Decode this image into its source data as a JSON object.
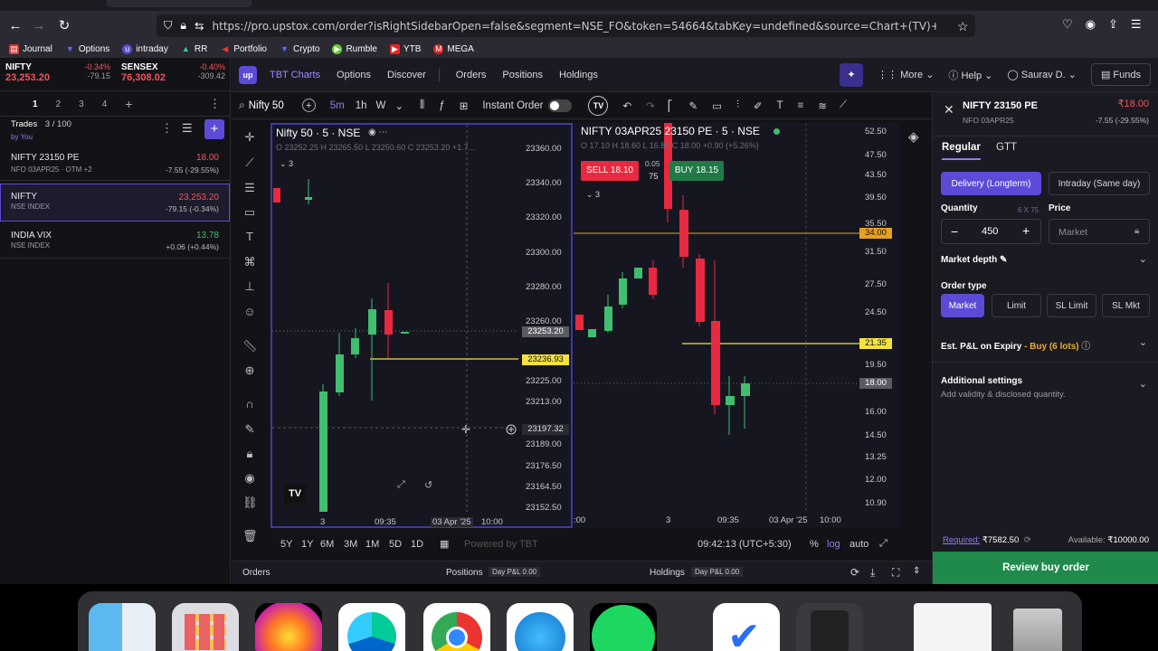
{
  "browser": {
    "url": "https://pro.upstox.com/order?isRightSidebarOpen=false&segment=NSE_FO&token=54664&tabKey=undefined&source=Chart+(TV)+Legend+CTA&action=B&order_ty",
    "bookmarks": [
      "Journal",
      "Options",
      "intraday",
      "RR",
      "Portfolio",
      "Crypto",
      "Rumble",
      "YTB",
      "MEGA"
    ]
  },
  "indices": {
    "nifty": {
      "name": "NIFTY",
      "value": "23,253.20",
      "change": "-0.34%",
      "points": "-79.15"
    },
    "sensex": {
      "name": "SENSEX",
      "value": "76,308.02",
      "change": "-0.40%",
      "points": "-309.42"
    }
  },
  "watchlist": {
    "tabs": [
      "1",
      "2",
      "3",
      "4"
    ],
    "trades_label": "Trades",
    "trades_count": "3 / 100",
    "by_you": "by You",
    "items": [
      {
        "name": "NIFTY 23150 PE",
        "sub": "NFO 03APR25",
        "tag": "OTM +2",
        "price": "18.00",
        "change": "-7.55 (-29.55%)",
        "dir": "down"
      },
      {
        "name": "NIFTY",
        "sub": "NSE INDEX",
        "tag": "",
        "price": "23,253.20",
        "change": "-79.15 (-0.34%)",
        "dir": "down"
      },
      {
        "name": "INDIA VIX",
        "sub": "NSE INDEX",
        "tag": "",
        "price": "13.78",
        "change": "+0.06 (+0.44%)",
        "dir": "up"
      }
    ]
  },
  "topnav": {
    "logo_text": "up",
    "items": [
      "TBT Charts",
      "Options",
      "Discover",
      "Orders",
      "Positions",
      "Holdings"
    ],
    "more": "More",
    "help": "Help",
    "user": "Saurav D.",
    "funds": "Funds"
  },
  "chart_toolbar": {
    "search": "Nifty 50",
    "intervals": [
      "5m",
      "1h",
      "W"
    ],
    "instant_order": "Instant Order"
  },
  "chart1": {
    "title": "Nifty 50 · 5 · NSE",
    "ohlc": "O 23252.25 H 23265.50 L 23250.60 C 23253.20 +1.7...",
    "legend_count": "3",
    "price_labels": [
      "23360.00",
      "23340.00",
      "23320.00",
      "23300.00",
      "23280.00",
      "23260.00",
      "23240.00",
      "23225.00",
      "23213.00",
      "23201.00",
      "23189.00",
      "23176.50",
      "23164.50",
      "23152.50"
    ],
    "last_price": "23253.20",
    "hline_price": "23236.93",
    "cursor_price": "23197.32",
    "time_labels": [
      "3",
      "09:35",
      "03 Apr '25",
      "10:00"
    ]
  },
  "chart2": {
    "title": "NIFTY 03APR25 23150 PE · 5 · NSE",
    "ohlc": "O 17.10 H 18.60 L 16.85 C 18.00 +0.90 (+5.26%)",
    "sell_label": "SELL 18.10",
    "buy_label": "BUY 18.15",
    "spread": "0.05",
    "qty": "75",
    "legend_count": "3",
    "price_labels": [
      "52.50",
      "47.50",
      "43.50",
      "39.50",
      "35.50",
      "31.50",
      "27.50",
      "24.50",
      "19.50",
      "16.00",
      "14.50",
      "13.25",
      "12.00",
      "10.90"
    ],
    "hline1": "34.00",
    "hline2": "21.35",
    "last_price": "18.00",
    "time_labels": [
      ":00",
      "3",
      "09:35",
      "03 Apr '25",
      "10:00"
    ]
  },
  "bottom_bar": {
    "ranges": [
      "5Y",
      "1Y",
      "6M",
      "3M",
      "1M",
      "5D",
      "1D"
    ],
    "powered": "Powered by TBT",
    "clock": "09:42:13 (UTC+5:30)",
    "pct": "%",
    "log": "log",
    "auto": "auto"
  },
  "orders_bar": {
    "orders": "Orders",
    "positions": "Positions",
    "holdings": "Holdings",
    "day_pl": "Day P&L",
    "day_pl_val": "0.00"
  },
  "order_panel": {
    "symbol": "NIFTY 23150 PE",
    "price": "₹18.00",
    "sub": "NFO 03APR25",
    "change": "-7.55 (-29.55%)",
    "tabs": [
      "Regular",
      "GTT"
    ],
    "product_types": [
      "Delivery (Longterm)",
      "Intraday (Same day)"
    ],
    "quantity_label": "Quantity",
    "lot_hint": "6 X 75",
    "price_label": "Price",
    "quantity": "450",
    "price_placeholder": "Market",
    "market_depth": "Market depth",
    "order_type_label": "Order type",
    "order_types": [
      "Market",
      "Limit",
      "SL Limit",
      "SL Mkt"
    ],
    "est_pl": "Est. P&L on Expiry",
    "est_pl_sub": "- Buy (6 lots)",
    "additional": "Additional settings",
    "additional_sub": "Add validity & disclosed quantity.",
    "required_label": "Required:",
    "required": "₹7582.50",
    "available_label": "Available:",
    "available": "₹10000.00",
    "cta": "Review buy order"
  },
  "colors": {
    "accent": "#5b4bd6",
    "up": "#3fbf6f",
    "down": "#f0555e",
    "cta": "#1f8a4c",
    "hline": "#f5e23c"
  }
}
